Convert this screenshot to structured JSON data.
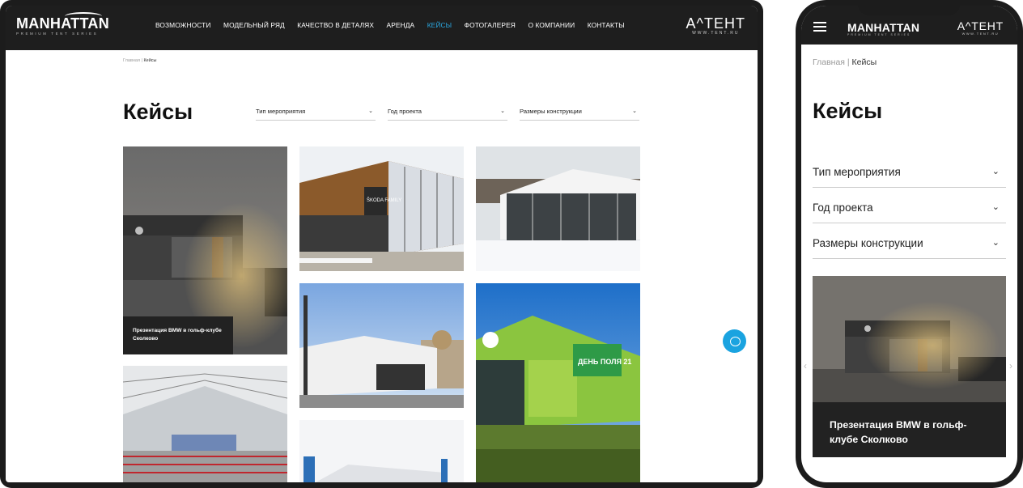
{
  "brand": {
    "manhattan": "MANHATTAN",
    "manhattan_tagline": "PREMIUM TENT SERIES",
    "atent": "А^ТЕНТ",
    "atent_url": "WWW.TENT.RU"
  },
  "nav": [
    {
      "label": "ВОЗМОЖНОСТИ",
      "active": false
    },
    {
      "label": "МОДЕЛЬНЫЙ РЯД",
      "active": false
    },
    {
      "label": "КАЧЕСТВО В ДЕТАЛЯХ",
      "active": false
    },
    {
      "label": "АРЕНДА",
      "active": false
    },
    {
      "label": "КЕЙСЫ",
      "active": true
    },
    {
      "label": "ФОТОГАЛЕРЕЯ",
      "active": false
    },
    {
      "label": "О КОМПАНИИ",
      "active": false
    },
    {
      "label": "КОНТАКТЫ",
      "active": false
    }
  ],
  "breadcrumb": {
    "home": "Главная",
    "separator": "|",
    "current": "Кейсы"
  },
  "page_title": "Кейсы",
  "filters": [
    {
      "label": "Тип мероприятия"
    },
    {
      "label": "Год проекта"
    },
    {
      "label": "Размеры конструкции"
    }
  ],
  "cases": [
    {
      "caption": "Презентация BMW в гольф-клубе Сколково"
    }
  ],
  "skoda_sign": "ŠKODA FAMILY",
  "green_sign": "ДЕНЬ ПОЛЯ 21",
  "colors": {
    "accent": "#2aa7e0",
    "header_bg": "#1e1e1e",
    "chat_button": "#1aa3e0"
  }
}
